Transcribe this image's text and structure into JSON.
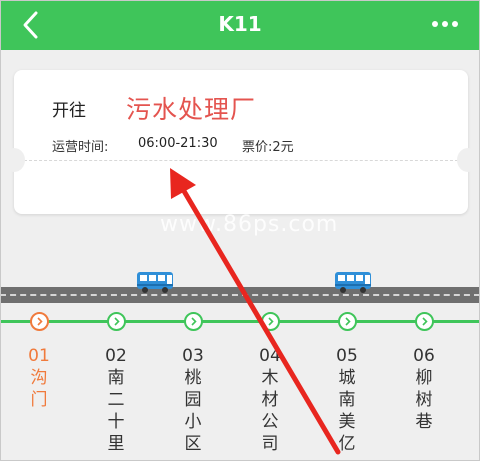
{
  "header": {
    "title": "K11",
    "back_icon": "chevron-left-icon",
    "more_icon": "more-horizontal-icon",
    "background_color": "#3fc55a"
  },
  "info_card": {
    "toward_label": "开往",
    "destination": "污水处理厂",
    "hours_label": "运营时间:",
    "hours_value": "06:00-21:30",
    "fare_text": "票价:2元",
    "destination_color": "#e4544f"
  },
  "watermark": "www.86ps.com",
  "route": {
    "line_color": "#3fc55a",
    "current_color": "#f07a3c",
    "stops": [
      {
        "index": "01",
        "name": "沟\n门",
        "current": true
      },
      {
        "index": "02",
        "name": "南\n二\n十\n里"
      },
      {
        "index": "03",
        "name": "桃\n园\n小\n区"
      },
      {
        "index": "04",
        "name": "木\n材\n公\n司"
      },
      {
        "index": "05",
        "name": "城\n南\n美\n亿"
      },
      {
        "index": "06",
        "name": "柳\n树\n巷"
      }
    ]
  },
  "buses": [
    "bus-icon",
    "bus-icon"
  ],
  "annotation_color": "#e8261f"
}
